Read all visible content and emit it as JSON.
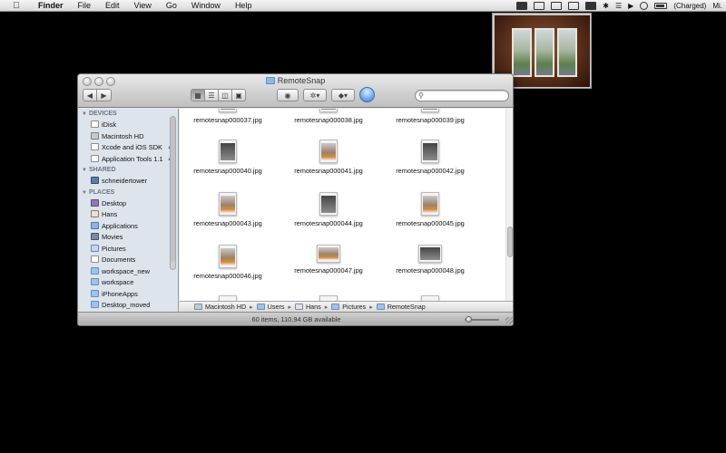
{
  "menubar": {
    "apple_icon": "apple-icon",
    "app_name": "Finder",
    "menus": [
      "File",
      "Edit",
      "View",
      "Go",
      "Window",
      "Help"
    ],
    "status_icons": [
      "camera-icon",
      "inbox-icon",
      "arrow-down-icon",
      "dropbox-icon",
      "display-icon",
      "bluetooth-icon",
      "wifi-icon",
      "volume-icon",
      "clock-icon"
    ],
    "battery_text": "(Charged)",
    "user_text": "Mi."
  },
  "finder": {
    "title": "RemoteSnap",
    "toolbar": {
      "back_glyph": "◀",
      "forward_glyph": "▶",
      "quicklook_glyph": "◉",
      "action_glyph": "✲▾",
      "dropbox_glyph": "◆▾",
      "search_placeholder": ""
    },
    "sidebar": {
      "sections": [
        {
          "title": "DEVICES",
          "items": [
            {
              "label": "iDisk",
              "icon": "doc"
            },
            {
              "label": "Macintosh HD",
              "icon": "disk"
            },
            {
              "label": "Xcode and iOS SDK",
              "icon": "doc",
              "eject": true
            },
            {
              "label": "Application Tools 1.1",
              "icon": "doc",
              "eject": true
            }
          ]
        },
        {
          "title": "SHARED",
          "items": [
            {
              "label": "schneidertower",
              "icon": "net"
            }
          ]
        },
        {
          "title": "PLACES",
          "items": [
            {
              "label": "Desktop",
              "icon": "desk"
            },
            {
              "label": "Hans",
              "icon": "home"
            },
            {
              "label": "Applications",
              "icon": "app"
            },
            {
              "label": "Movies",
              "icon": "movie"
            },
            {
              "label": "Pictures",
              "icon": "pics"
            },
            {
              "label": "Documents",
              "icon": "doc"
            },
            {
              "label": "workspace_new",
              "icon": "folder"
            },
            {
              "label": "workspace",
              "icon": "folder"
            },
            {
              "label": "iPhoneApps",
              "icon": "folder"
            },
            {
              "label": "Desktop_moved",
              "icon": "folder"
            }
          ]
        }
      ]
    },
    "files": [
      {
        "name": "remotesnap000037.jpg",
        "kind": "partial"
      },
      {
        "name": "remotesnap000038.jpg",
        "kind": "partial"
      },
      {
        "name": "remotesnap000039.jpg",
        "kind": "partial"
      },
      {
        "name": "remotesnap000040.jpg",
        "kind": "dark"
      },
      {
        "name": "remotesnap000041.jpg",
        "kind": "cup"
      },
      {
        "name": "remotesnap000042.jpg",
        "kind": "dark"
      },
      {
        "name": "remotesnap000043.jpg",
        "kind": "cup"
      },
      {
        "name": "remotesnap000044.jpg",
        "kind": "dark"
      },
      {
        "name": "remotesnap000045.jpg",
        "kind": "cup"
      },
      {
        "name": "remotesnap000046.jpg",
        "kind": "cup"
      },
      {
        "name": "remotesnap000047.jpg",
        "kind": "wide-cup"
      },
      {
        "name": "remotesnap000048.jpg",
        "kind": "wide-dark"
      }
    ],
    "path": [
      "Macintosh HD",
      "Users",
      "Hans",
      "Pictures",
      "RemoteSnap"
    ],
    "status_text": "60 items, 110,94 GB available"
  }
}
